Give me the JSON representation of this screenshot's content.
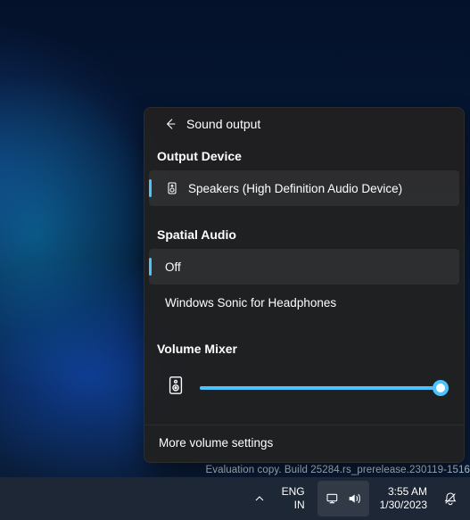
{
  "flyout": {
    "title": "Sound output",
    "sections": {
      "outputDevice": {
        "label": "Output Device",
        "items": [
          {
            "label": "Speakers (High Definition Audio Device)",
            "selected": true
          }
        ]
      },
      "spatialAudio": {
        "label": "Spatial Audio",
        "items": [
          {
            "label": "Off",
            "selected": true
          },
          {
            "label": "Windows Sonic for Headphones",
            "selected": false
          }
        ]
      },
      "volumeMixer": {
        "label": "Volume Mixer",
        "valuePercent": 97
      }
    },
    "footer": {
      "label": "More volume settings"
    }
  },
  "watermark": "Evaluation copy. Build 25284.rs_prerelease.230119-1516",
  "taskbar": {
    "language": {
      "line1": "ENG",
      "line2": "IN"
    },
    "datetime": {
      "time": "3:55 AM",
      "date": "1/30/2023"
    }
  }
}
